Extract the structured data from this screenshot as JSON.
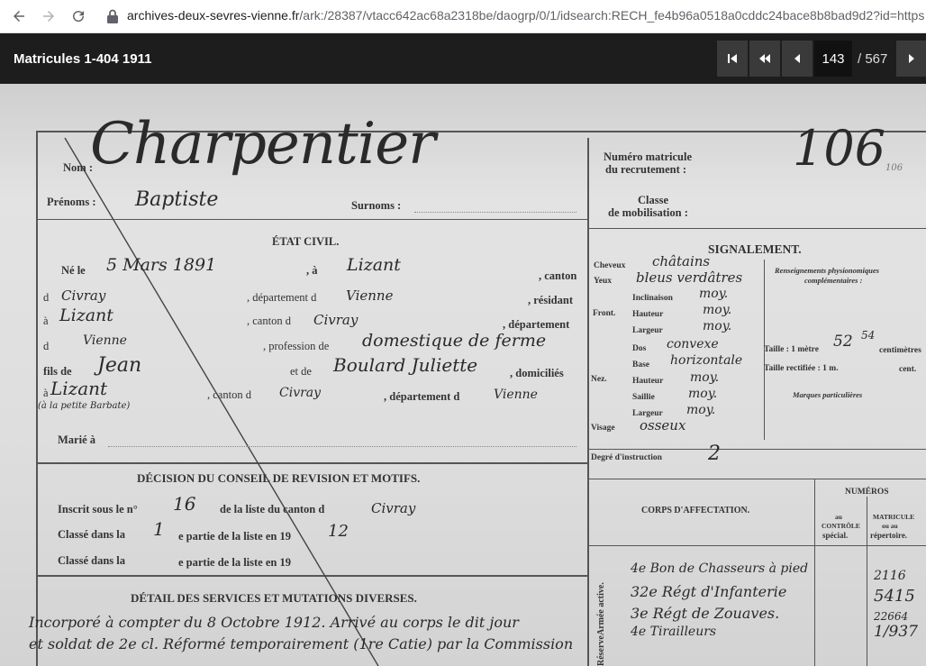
{
  "browser": {
    "url_host": "archives-deux-sevres-vienne.fr",
    "url_path": "/ark:/28387/vtacc642ac68a2318be/daogrp/0/1/idsearch:RECH_fe4b96a0518a0cddc24bace8b8bad9d2?id=https%..."
  },
  "viewer": {
    "title": "Matricules 1-404 1911",
    "current_page": "143",
    "total_pages": "/ 567"
  },
  "doc": {
    "nom_label": "Nom :",
    "nom_value": "Charpentier",
    "prenoms_label": "Prénoms :",
    "prenoms_value": "Baptiste",
    "surnoms_label": "Surnoms :",
    "numero_label_1": "Numéro matricule",
    "numero_label_2": "du recrutement :",
    "numero_value": "106",
    "numero_small": "106",
    "classe_label_1": "Classe",
    "classe_label_2": "de mobilisation :",
    "etat_civil": "ÉTAT CIVIL.",
    "ne_le": "Né le",
    "ne_le_value": "5 Mars 1891",
    "a_label": ", à",
    "a_value": "Lizant",
    "canton": ", canton",
    "d1": "d",
    "d1_value": "Civray",
    "dept_d": ", département d",
    "dept_value": "Vienne",
    "resident": ", résidant",
    "a2": "à",
    "a2_value": "Lizant",
    "canton_d": ", canton d",
    "canton_value": "Civray",
    "departement": ", département",
    "d2": "d",
    "d2_value": "Vienne",
    "profession_label": ", profession de",
    "profession_value": "domestique de ferme",
    "fils_de": "fils de",
    "pere_value": "Jean",
    "et_de": "et de",
    "mere_value": "Boulard Juliette",
    "domicilies": ", domiciliés",
    "a3": "à",
    "a3_value": "Lizant",
    "a3_note": "(à la petite Barbate)",
    "canton_d2": ", canton d",
    "canton2_value": "Civray",
    "dept_d2": ", département d",
    "dept2_value": "Vienne",
    "marie": "Marié à",
    "signalement": "SIGNALEMENT.",
    "cheveux": "Cheveux",
    "cheveux_value": "châtains",
    "yeux": "Yeux",
    "yeux_value": "bleus verdâtres",
    "front": "Front.",
    "inclinaison": "Inclinaison",
    "inclinaison_value": "moy.",
    "hauteur": "Hauteur",
    "hauteur_value": "moy.",
    "largeur": "Largeur",
    "largeur_value": "moy.",
    "nez": "Nez.",
    "dos": "Dos",
    "dos_value": "convexe",
    "base": "Base",
    "base_value": "horizontale",
    "nez_hauteur": "Hauteur",
    "nez_hauteur_value": "moy.",
    "saillie": "Saillie",
    "saillie_value": "moy.",
    "nez_largeur": "Largeur",
    "nez_largeur_value": "moy.",
    "visage": "Visage",
    "visage_value": "osseux",
    "renseignements_1": "Renseignements physionomiques",
    "renseignements_2": "complémentaires :",
    "taille_label": "Taille : 1 mètre",
    "taille_value": "52",
    "taille_cm": "54",
    "centimetres": "centimètres",
    "taille_rectifiee": "Taille rectifiée : 1 m.",
    "cent": "cent.",
    "marques": "Marques particulières",
    "degre_label": "Degré d'instruction",
    "degre_value": "2",
    "decision_title": "DÉCISION DU CONSEIL DE REVISION ET MOTIFS.",
    "inscrit_label": "Inscrit sous le n°",
    "inscrit_value": "16",
    "liste_canton": "de la liste du canton d",
    "liste_canton_value": "Civray",
    "classe_dans_la": "Classé dans la",
    "classe1_value": "1",
    "partie_liste": "e partie de la liste en 19",
    "classe1_year": "12",
    "classe_dans_la2": "Classé dans la",
    "partie_liste2": "e partie de la liste en 19",
    "corps_affectation": "CORPS D'AFFECTATION.",
    "numeros": "NUMÉROS",
    "au_controle_1": "au",
    "au_controle_2": "CONTRÔLE",
    "au_controle_3": "spécial.",
    "matricule_1": "MATRICULE",
    "matricule_2": "ou au",
    "matricule_3": "répertoire.",
    "armee_active": "Armée active.",
    "reserve": "Réserve",
    "corps_1": "4e Bon de Chasseurs à pied",
    "corps_2": "32e Régt d'Infanterie",
    "corps_3": "3e Régt de Zouaves.",
    "corps_4": "4e Tirailleurs",
    "num_1": "2116",
    "num_2": "5415",
    "num_3": "22664",
    "num_4": "1/937",
    "detail_title": "DÉTAIL DES SERVICES ET MUTATIONS DIVERSES.",
    "detail_line1": "Incorporé à compter du 8 Octobre 1912. Arrivé au corps le dit jour",
    "detail_line2": "et soldat de 2e cl. Réformé temporairement (1re Catie) par la Commission"
  }
}
